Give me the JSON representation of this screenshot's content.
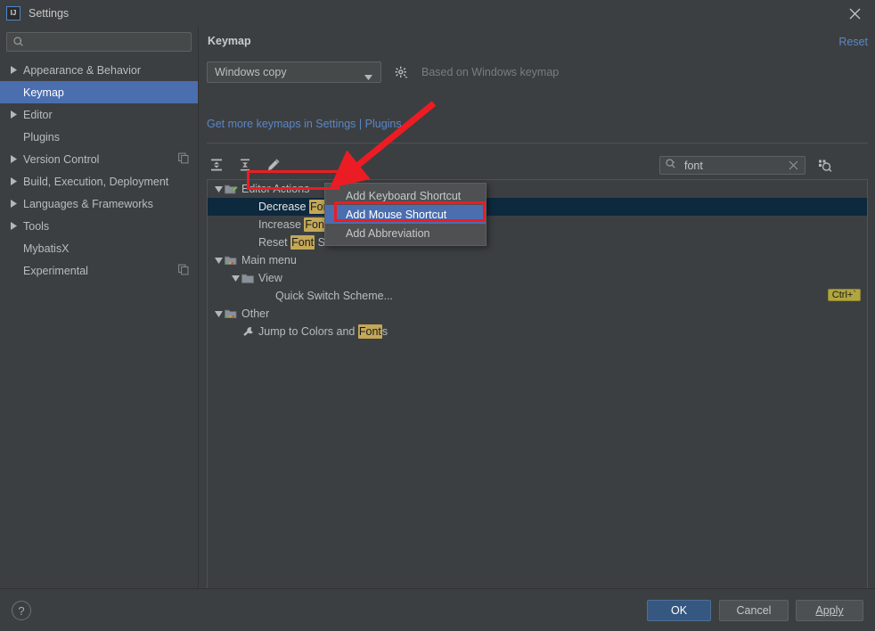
{
  "window": {
    "title": "Settings",
    "app_icon": "intellij-idea-icon",
    "close_icon": "close-icon"
  },
  "sidebar": {
    "search": {
      "placeholder": "",
      "value": "",
      "icon": "search-icon"
    },
    "items": [
      {
        "label": "Appearance & Behavior",
        "expandable": true,
        "selected": false,
        "badge": ""
      },
      {
        "label": "Keymap",
        "expandable": false,
        "selected": true,
        "badge": ""
      },
      {
        "label": "Editor",
        "expandable": true,
        "selected": false,
        "badge": ""
      },
      {
        "label": "Plugins",
        "expandable": false,
        "selected": false,
        "badge": ""
      },
      {
        "label": "Version Control",
        "expandable": true,
        "selected": false,
        "badge": "copy-icon"
      },
      {
        "label": "Build, Execution, Deployment",
        "expandable": true,
        "selected": false,
        "badge": ""
      },
      {
        "label": "Languages & Frameworks",
        "expandable": true,
        "selected": false,
        "badge": ""
      },
      {
        "label": "Tools",
        "expandable": true,
        "selected": false,
        "badge": ""
      },
      {
        "label": "MybatisX",
        "expandable": false,
        "selected": false,
        "badge": ""
      },
      {
        "label": "Experimental",
        "expandable": false,
        "selected": false,
        "badge": "copy-icon"
      }
    ]
  },
  "panel": {
    "title": "Keymap",
    "reset_label": "Reset",
    "keymap_select": {
      "value": "Windows copy",
      "icon": "chevron-down-icon"
    },
    "gear_icon": "gear-icon",
    "based_on_text": "Based on Windows keymap",
    "plugins_link": "Get more keymaps in Settings | Plugins",
    "toolbar": [
      {
        "name": "expand-all-icon",
        "label": "Expand All"
      },
      {
        "name": "collapse-all-icon",
        "label": "Collapse All"
      },
      {
        "name": "edit-pencil-icon",
        "label": "Edit Shortcut"
      }
    ],
    "tree_search": {
      "value": "font",
      "placeholder": "",
      "icon": "search-icon",
      "clear_icon": "clear-x-icon"
    },
    "find_by_shortcut_icon": "find-by-shortcut-icon"
  },
  "tree": {
    "highlight_term": "Font",
    "rows": [
      {
        "indent": 0,
        "arrow": "down",
        "icon": "editor-actions-folder-icon",
        "text": "Editor Actions",
        "selected": false,
        "shortcut": ""
      },
      {
        "indent": 1,
        "arrow": "none",
        "icon": "none",
        "text": "Decrease Font Size",
        "selected": true,
        "shortcut": ""
      },
      {
        "indent": 1,
        "arrow": "none",
        "icon": "none",
        "text": "Increase Font Size",
        "selected": false,
        "shortcut": ""
      },
      {
        "indent": 1,
        "arrow": "none",
        "icon": "none",
        "text": "Reset Font Size",
        "selected": false,
        "shortcut": ""
      },
      {
        "indent": 0,
        "arrow": "down",
        "icon": "main-menu-folder-icon",
        "text": "Main menu",
        "selected": false,
        "shortcut": ""
      },
      {
        "indent": 1,
        "arrow": "down",
        "icon": "folder-icon",
        "text": "View",
        "selected": false,
        "shortcut": ""
      },
      {
        "indent": 2,
        "arrow": "none",
        "icon": "none",
        "text": "Quick Switch Scheme...",
        "selected": false,
        "shortcut": "Ctrl+`"
      },
      {
        "indent": 0,
        "arrow": "down",
        "icon": "other-folder-icon",
        "text": "Other",
        "selected": false,
        "shortcut": ""
      },
      {
        "indent": 1,
        "arrow": "none",
        "icon": "wrench-icon",
        "text": "Jump to Colors and Fonts",
        "selected": false,
        "shortcut": ""
      }
    ]
  },
  "context_menu": {
    "items": [
      {
        "label": "Add Keyboard Shortcut",
        "active": false
      },
      {
        "label": "Add Mouse Shortcut",
        "active": true
      },
      {
        "label": "Add Abbreviation",
        "active": false
      }
    ]
  },
  "footer": {
    "help_icon": "help-question-icon",
    "ok_label": "OK",
    "cancel_label": "Cancel",
    "apply_label": "Apply"
  },
  "annotations": {
    "arrow_color": "#ec1c24",
    "box_color": "#ec1c24"
  }
}
